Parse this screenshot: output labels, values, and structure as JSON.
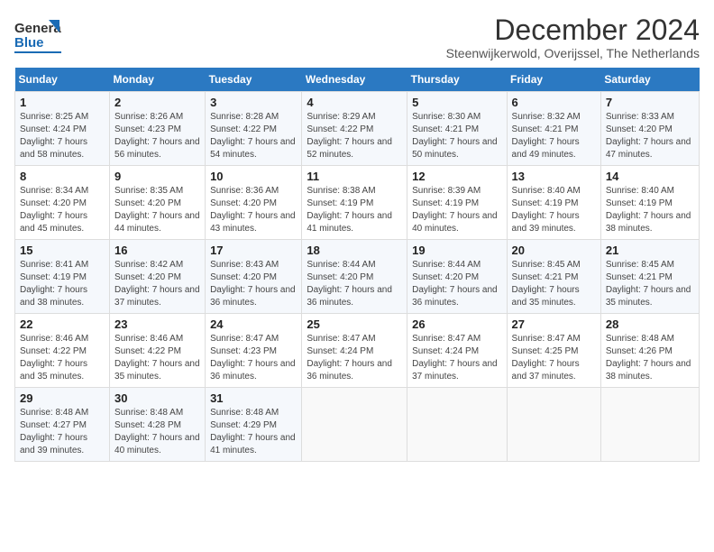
{
  "header": {
    "logo_general": "General",
    "logo_blue": "Blue",
    "month": "December 2024",
    "location": "Steenwijkerwold, Overijssel, The Netherlands"
  },
  "weekdays": [
    "Sunday",
    "Monday",
    "Tuesday",
    "Wednesday",
    "Thursday",
    "Friday",
    "Saturday"
  ],
  "weeks": [
    [
      {
        "day": "1",
        "sunrise": "Sunrise: 8:25 AM",
        "sunset": "Sunset: 4:24 PM",
        "daylight": "Daylight: 7 hours and 58 minutes."
      },
      {
        "day": "2",
        "sunrise": "Sunrise: 8:26 AM",
        "sunset": "Sunset: 4:23 PM",
        "daylight": "Daylight: 7 hours and 56 minutes."
      },
      {
        "day": "3",
        "sunrise": "Sunrise: 8:28 AM",
        "sunset": "Sunset: 4:22 PM",
        "daylight": "Daylight: 7 hours and 54 minutes."
      },
      {
        "day": "4",
        "sunrise": "Sunrise: 8:29 AM",
        "sunset": "Sunset: 4:22 PM",
        "daylight": "Daylight: 7 hours and 52 minutes."
      },
      {
        "day": "5",
        "sunrise": "Sunrise: 8:30 AM",
        "sunset": "Sunset: 4:21 PM",
        "daylight": "Daylight: 7 hours and 50 minutes."
      },
      {
        "day": "6",
        "sunrise": "Sunrise: 8:32 AM",
        "sunset": "Sunset: 4:21 PM",
        "daylight": "Daylight: 7 hours and 49 minutes."
      },
      {
        "day": "7",
        "sunrise": "Sunrise: 8:33 AM",
        "sunset": "Sunset: 4:20 PM",
        "daylight": "Daylight: 7 hours and 47 minutes."
      }
    ],
    [
      {
        "day": "8",
        "sunrise": "Sunrise: 8:34 AM",
        "sunset": "Sunset: 4:20 PM",
        "daylight": "Daylight: 7 hours and 45 minutes."
      },
      {
        "day": "9",
        "sunrise": "Sunrise: 8:35 AM",
        "sunset": "Sunset: 4:20 PM",
        "daylight": "Daylight: 7 hours and 44 minutes."
      },
      {
        "day": "10",
        "sunrise": "Sunrise: 8:36 AM",
        "sunset": "Sunset: 4:20 PM",
        "daylight": "Daylight: 7 hours and 43 minutes."
      },
      {
        "day": "11",
        "sunrise": "Sunrise: 8:38 AM",
        "sunset": "Sunset: 4:19 PM",
        "daylight": "Daylight: 7 hours and 41 minutes."
      },
      {
        "day": "12",
        "sunrise": "Sunrise: 8:39 AM",
        "sunset": "Sunset: 4:19 PM",
        "daylight": "Daylight: 7 hours and 40 minutes."
      },
      {
        "day": "13",
        "sunrise": "Sunrise: 8:40 AM",
        "sunset": "Sunset: 4:19 PM",
        "daylight": "Daylight: 7 hours and 39 minutes."
      },
      {
        "day": "14",
        "sunrise": "Sunrise: 8:40 AM",
        "sunset": "Sunset: 4:19 PM",
        "daylight": "Daylight: 7 hours and 38 minutes."
      }
    ],
    [
      {
        "day": "15",
        "sunrise": "Sunrise: 8:41 AM",
        "sunset": "Sunset: 4:19 PM",
        "daylight": "Daylight: 7 hours and 38 minutes."
      },
      {
        "day": "16",
        "sunrise": "Sunrise: 8:42 AM",
        "sunset": "Sunset: 4:20 PM",
        "daylight": "Daylight: 7 hours and 37 minutes."
      },
      {
        "day": "17",
        "sunrise": "Sunrise: 8:43 AM",
        "sunset": "Sunset: 4:20 PM",
        "daylight": "Daylight: 7 hours and 36 minutes."
      },
      {
        "day": "18",
        "sunrise": "Sunrise: 8:44 AM",
        "sunset": "Sunset: 4:20 PM",
        "daylight": "Daylight: 7 hours and 36 minutes."
      },
      {
        "day": "19",
        "sunrise": "Sunrise: 8:44 AM",
        "sunset": "Sunset: 4:20 PM",
        "daylight": "Daylight: 7 hours and 36 minutes."
      },
      {
        "day": "20",
        "sunrise": "Sunrise: 8:45 AM",
        "sunset": "Sunset: 4:21 PM",
        "daylight": "Daylight: 7 hours and 35 minutes."
      },
      {
        "day": "21",
        "sunrise": "Sunrise: 8:45 AM",
        "sunset": "Sunset: 4:21 PM",
        "daylight": "Daylight: 7 hours and 35 minutes."
      }
    ],
    [
      {
        "day": "22",
        "sunrise": "Sunrise: 8:46 AM",
        "sunset": "Sunset: 4:22 PM",
        "daylight": "Daylight: 7 hours and 35 minutes."
      },
      {
        "day": "23",
        "sunrise": "Sunrise: 8:46 AM",
        "sunset": "Sunset: 4:22 PM",
        "daylight": "Daylight: 7 hours and 35 minutes."
      },
      {
        "day": "24",
        "sunrise": "Sunrise: 8:47 AM",
        "sunset": "Sunset: 4:23 PM",
        "daylight": "Daylight: 7 hours and 36 minutes."
      },
      {
        "day": "25",
        "sunrise": "Sunrise: 8:47 AM",
        "sunset": "Sunset: 4:24 PM",
        "daylight": "Daylight: 7 hours and 36 minutes."
      },
      {
        "day": "26",
        "sunrise": "Sunrise: 8:47 AM",
        "sunset": "Sunset: 4:24 PM",
        "daylight": "Daylight: 7 hours and 37 minutes."
      },
      {
        "day": "27",
        "sunrise": "Sunrise: 8:47 AM",
        "sunset": "Sunset: 4:25 PM",
        "daylight": "Daylight: 7 hours and 37 minutes."
      },
      {
        "day": "28",
        "sunrise": "Sunrise: 8:48 AM",
        "sunset": "Sunset: 4:26 PM",
        "daylight": "Daylight: 7 hours and 38 minutes."
      }
    ],
    [
      {
        "day": "29",
        "sunrise": "Sunrise: 8:48 AM",
        "sunset": "Sunset: 4:27 PM",
        "daylight": "Daylight: 7 hours and 39 minutes."
      },
      {
        "day": "30",
        "sunrise": "Sunrise: 8:48 AM",
        "sunset": "Sunset: 4:28 PM",
        "daylight": "Daylight: 7 hours and 40 minutes."
      },
      {
        "day": "31",
        "sunrise": "Sunrise: 8:48 AM",
        "sunset": "Sunset: 4:29 PM",
        "daylight": "Daylight: 7 hours and 41 minutes."
      },
      null,
      null,
      null,
      null
    ]
  ]
}
